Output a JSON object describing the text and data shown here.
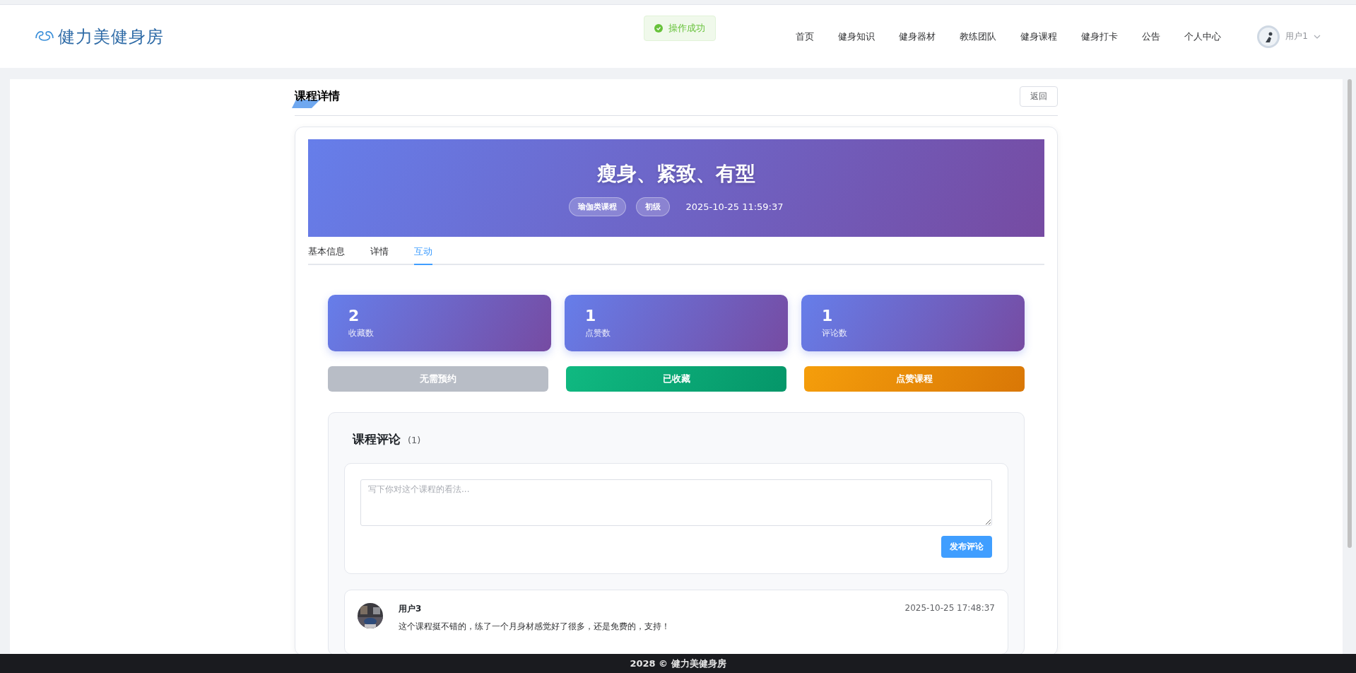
{
  "header": {
    "logo": "健力美健身房",
    "toast": "操作成功",
    "nav": [
      {
        "label": "首页",
        "selected": false
      },
      {
        "label": "健身知识",
        "selected": false
      },
      {
        "label": "健身器材",
        "selected": false
      },
      {
        "label": "教练团队",
        "selected": false
      },
      {
        "label": "健身课程",
        "selected": false
      },
      {
        "label": "健身打卡",
        "selected": false
      },
      {
        "label": "公告",
        "selected": false
      },
      {
        "label": "个人中心",
        "selected": false
      }
    ],
    "user": "用户1"
  },
  "page": {
    "title": "课程详情",
    "back": "返回"
  },
  "course": {
    "title": "瘦身、紧致、有型",
    "tags": [
      "瑜伽类课程",
      "初级"
    ],
    "time": "2025-10-25 11:59:37"
  },
  "tabs": [
    {
      "label": "基本信息",
      "selected": false
    },
    {
      "label": "详情",
      "selected": false
    },
    {
      "label": "互动",
      "selected": true
    }
  ],
  "stats": [
    {
      "value": "2",
      "label": "收藏数"
    },
    {
      "value": "1",
      "label": "点赞数"
    },
    {
      "value": "1",
      "label": "评论数"
    }
  ],
  "actions": [
    {
      "label": "无需预约",
      "kind": "disabled"
    },
    {
      "label": "已收藏",
      "kind": "success"
    },
    {
      "label": "点赞课程",
      "kind": "warning"
    }
  ],
  "comments_section": {
    "title": "课程评论",
    "count": "(1)",
    "placeholder": "写下你对这个课程的看法...",
    "submit": "发布评论",
    "comments": [
      {
        "user": "用户3",
        "time": "2025-10-25 17:48:37",
        "text": "这个课程挺不错的，练了一个月身材感觉好了很多，还是免费的，支持！"
      }
    ]
  },
  "footer": "2028 © 健力美健身房"
}
